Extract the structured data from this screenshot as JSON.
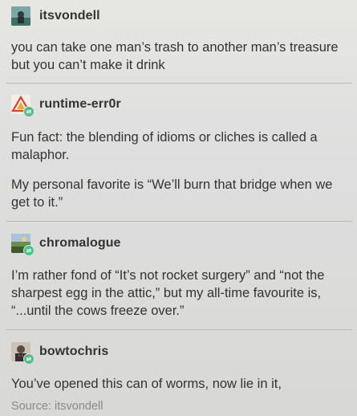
{
  "posts": [
    {
      "username": "itsvondell",
      "paragraphs": [
        "you can take one man’s trash to another man’s treasure but you can’t make it drink"
      ]
    },
    {
      "username": "runtime-err0r",
      "paragraphs": [
        "Fun fact: the blending of idioms or cliches is called a malaphor.",
        "My personal favorite is “We’ll burn that bridge when we get to it.”"
      ]
    },
    {
      "username": "chromalogue",
      "paragraphs": [
        "I’m rather fond of “It’s not rocket surgery” and “not the sharpest egg in the attic,” but my all-time favourite is, “...until the cows freeze over.”"
      ]
    },
    {
      "username": "bowtochris",
      "paragraphs": [
        "You’ve opened this can of worms, now lie in it,"
      ]
    }
  ],
  "source": "Source: itsvondell",
  "colors": {
    "reblog_badge": "#56bc8a",
    "text": "#333333",
    "source": "#8a8a88"
  },
  "icons": [
    "avatar-itsvondell",
    "avatar-runtime-err0r",
    "avatar-chromalogue",
    "avatar-bowtochris",
    "reblog-icon"
  ]
}
